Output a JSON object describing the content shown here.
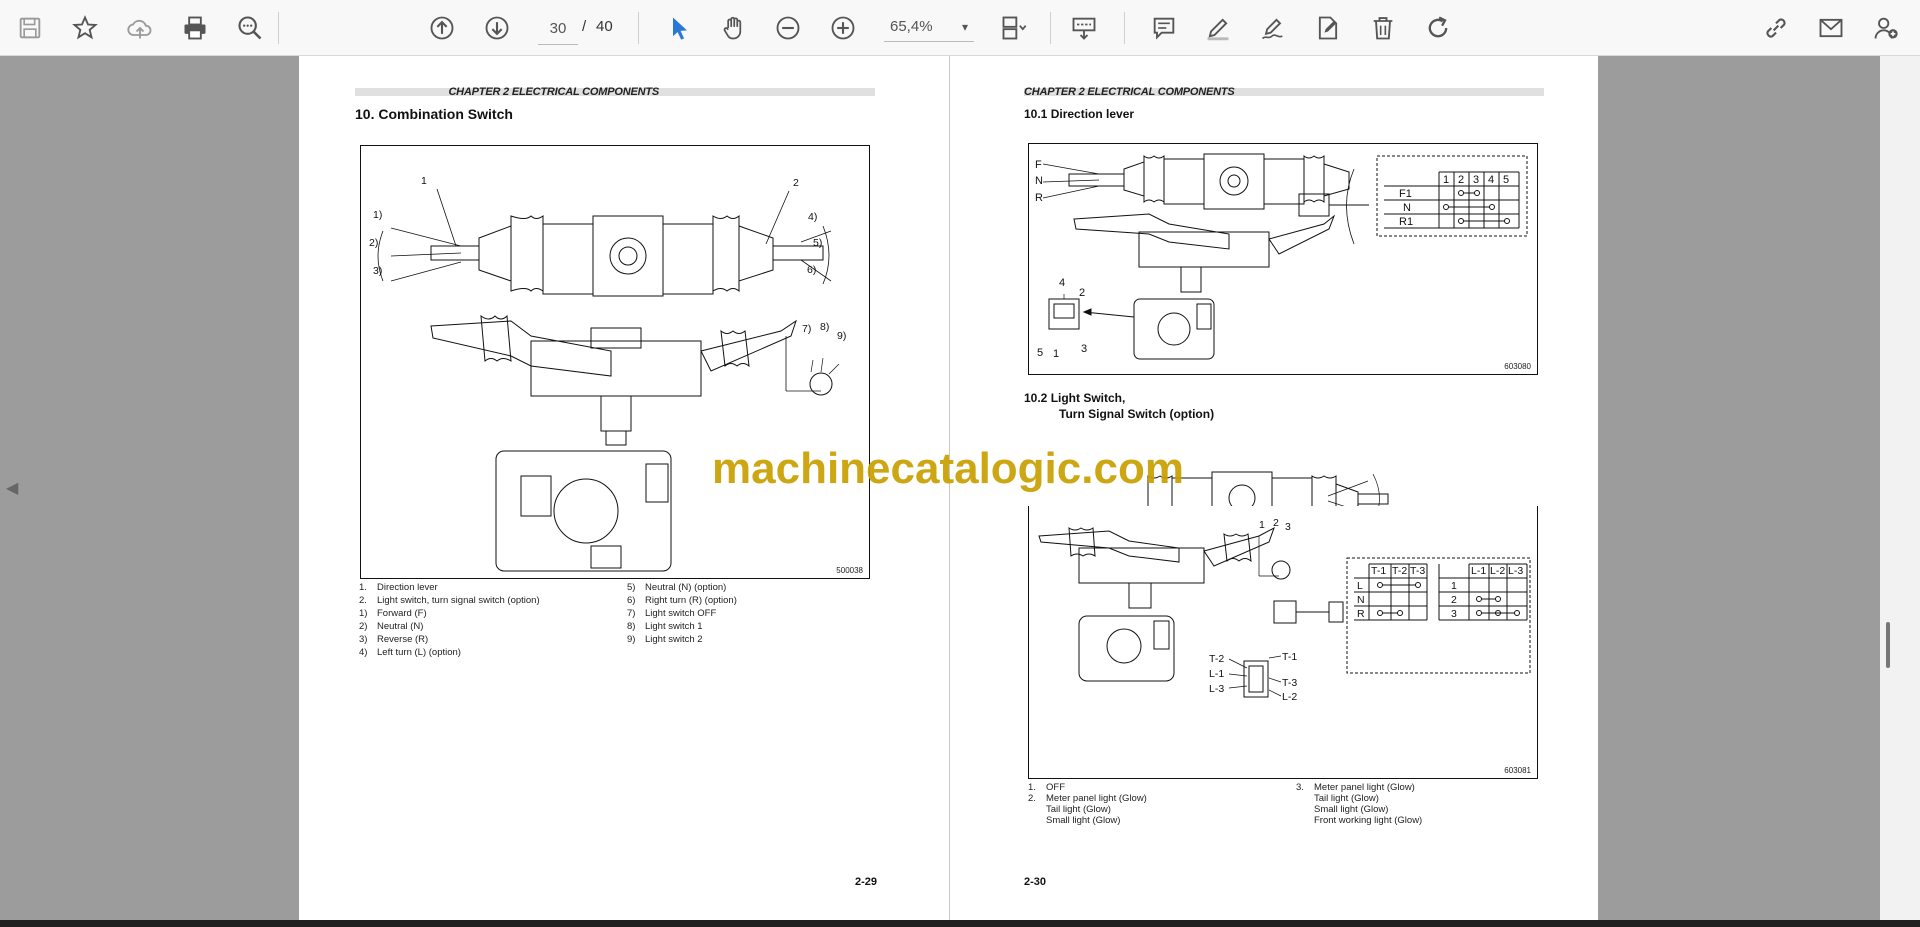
{
  "toolbar": {
    "icons": [
      "save-icon",
      "bookmark-star-icon",
      "cloud-upload-icon",
      "print-icon",
      "zoom-find-icon",
      "arrow-up-circle-icon",
      "arrow-down-circle-icon",
      "select-cursor-icon",
      "hand-tool-icon",
      "zoom-out-icon",
      "zoom-in-icon",
      "fit-page-icon",
      "edit-text-icon",
      "comment-icon",
      "highlight-pen-icon",
      "signature-icon",
      "fill-sign-icon",
      "delete-icon",
      "redo-icon",
      "share-link-icon",
      "email-icon",
      "add-user-icon"
    ],
    "page_current": "30",
    "page_separator": "/",
    "page_total": "40",
    "zoom_value": "65,4%",
    "zoom_caret": "▾"
  },
  "left_page": {
    "chapter": "CHAPTER 2 ELECTRICAL COMPONENTS",
    "section_title": "10.  Combination Switch",
    "figure_no": "500038",
    "labels": [
      "1",
      "2",
      "1)",
      "2)",
      "3)",
      "4)",
      "5)",
      "6)",
      "7)",
      "8)",
      "9)"
    ],
    "legend_left": [
      "1.",
      "Direction lever",
      "2.",
      "Light switch, turn signal switch (option)",
      "1)",
      "Forward (F)",
      "2)",
      "Neutral (N)",
      "3)",
      "Reverse (R)",
      "4)",
      "Left turn (L) (option)"
    ],
    "legend_right": [
      "5)",
      "Neutral (N) (option)",
      "6)",
      "Right turn (R) (option)",
      "7)",
      "Light switch OFF",
      "8)",
      "Light switch 1",
      "9)",
      "Light switch 2"
    ],
    "page_number": "2-29"
  },
  "right_page": {
    "chapter": "CHAPTER 2 ELECTRICAL COMPONENTS",
    "sub1": "10.1    Direction lever",
    "sub2_line1": "10.2    Light Switch,",
    "sub2_line2": "Turn Signal Switch (option)",
    "fig1_no": "603080",
    "fig2_no": "603081",
    "fig1_lever": [
      "F",
      "N",
      "R"
    ],
    "fig1_pins": [
      "4",
      "2",
      "5",
      "1",
      "3"
    ],
    "fig1_table_head": [
      "1",
      "2",
      "3",
      "4",
      "5"
    ],
    "fig1_table_rows": [
      "F1",
      "N",
      "R1"
    ],
    "fig2_lever": [
      "N",
      "R"
    ],
    "fig2_knob": [
      "1",
      "2",
      "3"
    ],
    "fig2_conn": [
      "T-2",
      "T-1",
      "L-1",
      "T-3",
      "L-3",
      "L-2"
    ],
    "fig2_t_head": [
      "T-1",
      "T-2",
      "T-3"
    ],
    "fig2_t_rows": [
      "L",
      "N",
      "R"
    ],
    "fig2_l_head": [
      "L-1",
      "L-2",
      "L-3"
    ],
    "fig2_l_rows": [
      "1",
      "2",
      "3"
    ],
    "legend_left": [
      "1.",
      "OFF",
      "2.",
      "Meter panel light (Glow)",
      "Tail light (Glow)",
      "Small light (Glow)"
    ],
    "legend_right": [
      "3.",
      "Meter panel light (Glow)",
      "Tail light (Glow)",
      "Small light (Glow)",
      "Front working light (Glow)"
    ],
    "page_number": "2-30"
  },
  "watermark": "machinecatalogic.com",
  "nav": {
    "prev": "◀",
    "next": "◀"
  },
  "colors": {
    "accent": "#2a78d6",
    "watermark": "#c9a000",
    "icon": "#555555"
  }
}
